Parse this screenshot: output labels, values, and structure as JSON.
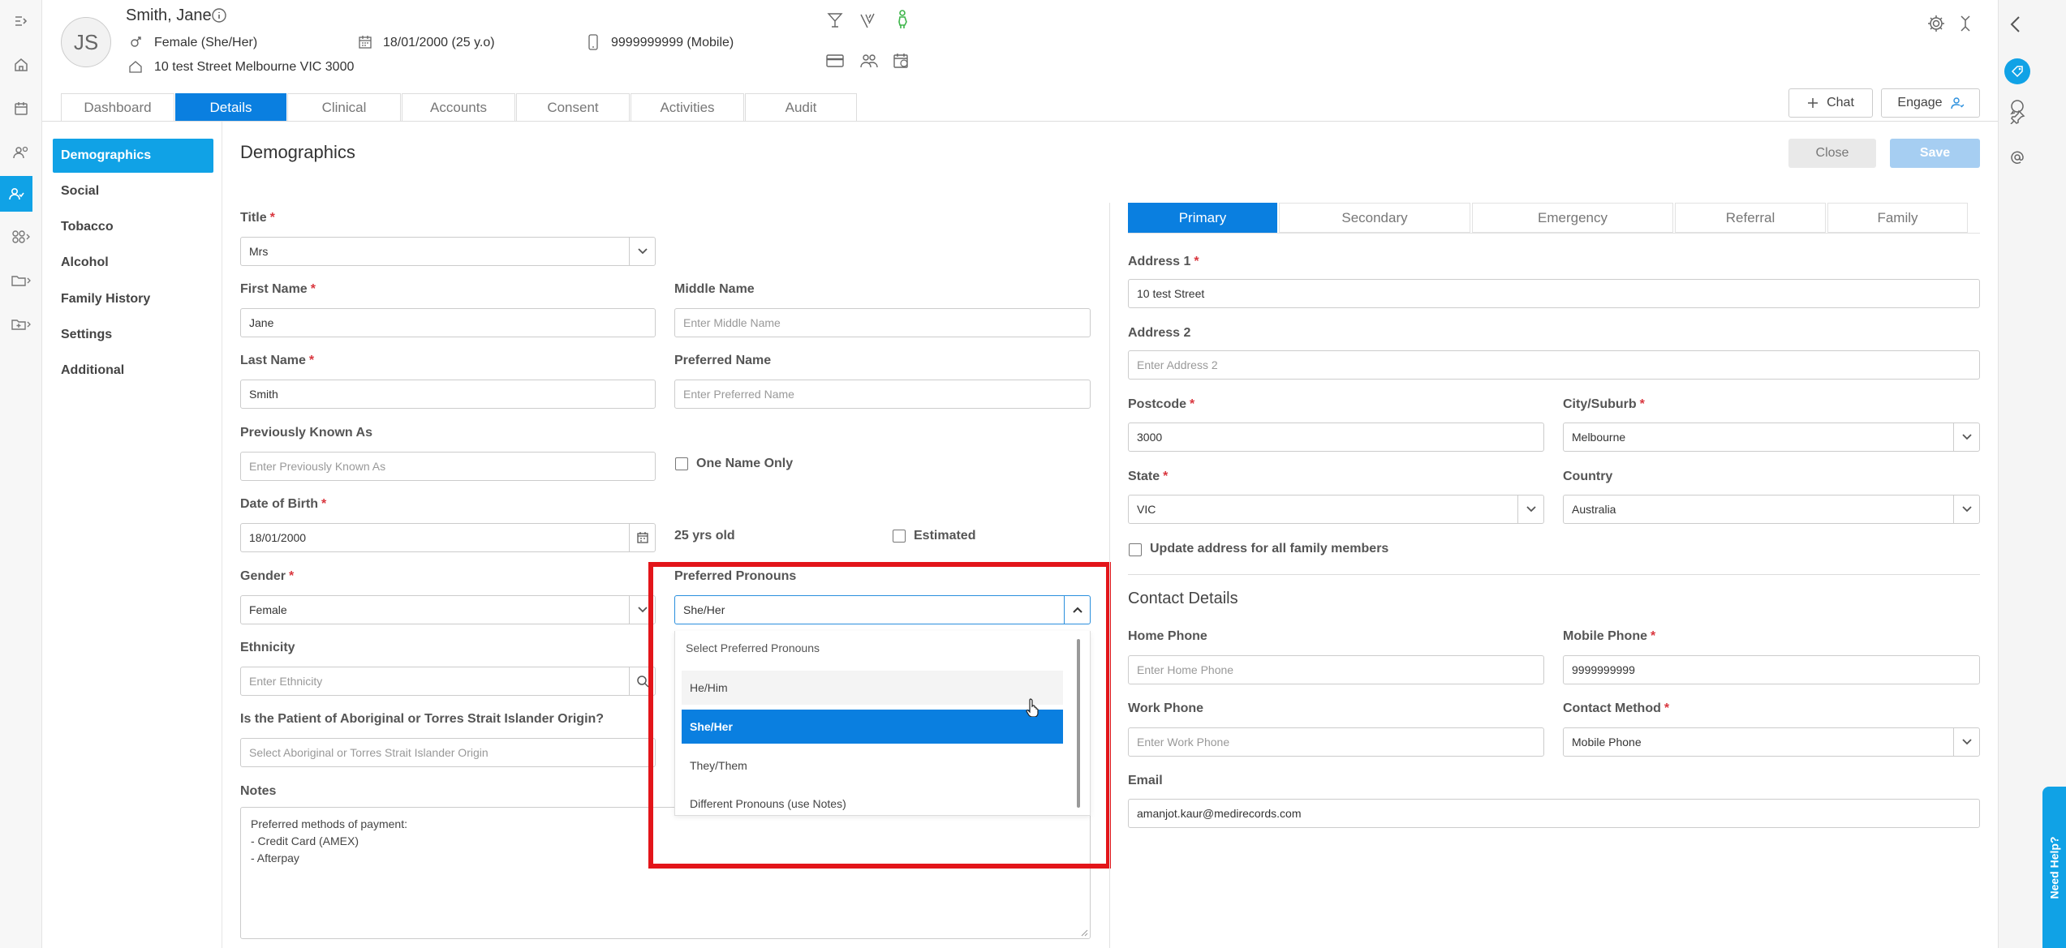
{
  "patient": {
    "initials": "JS",
    "name": "Smith, Jane",
    "gender": "Female (She/Her)",
    "dob": "18/01/2000 (25 y.o)",
    "phone": "9999999999 (Mobile)",
    "address": "10 test Street Melbourne VIC 3000"
  },
  "header_buttons": {
    "chat": "Chat",
    "engage": "Engage"
  },
  "main_tabs": [
    "Dashboard",
    "Details",
    "Clinical",
    "Accounts",
    "Consent",
    "Activities",
    "Audit"
  ],
  "sidebar": [
    "Demographics",
    "Social",
    "Tobacco",
    "Alcohol",
    "Family History",
    "Settings",
    "Additional"
  ],
  "page": {
    "title": "Demographics",
    "close": "Close",
    "save": "Save"
  },
  "form": {
    "title_label": "Title",
    "title_value": "Mrs",
    "first_name_label": "First Name",
    "first_name_value": "Jane",
    "middle_name_label": "Middle Name",
    "middle_name_placeholder": "Enter Middle Name",
    "last_name_label": "Last Name",
    "last_name_value": "Smith",
    "preferred_name_label": "Preferred Name",
    "preferred_name_placeholder": "Enter Preferred Name",
    "prev_known_label": "Previously Known As",
    "prev_known_placeholder": "Enter Previously Known As",
    "one_name_only": "One Name Only",
    "dob_label": "Date of Birth",
    "dob_value": "18/01/2000",
    "age_text": "25 yrs old",
    "estimated": "Estimated",
    "gender_label": "Gender",
    "gender_value": "Female",
    "pronouns_label": "Preferred Pronouns",
    "pronouns_value": "She/Her",
    "ethnicity_label": "Ethnicity",
    "ethnicity_placeholder": "Enter Ethnicity",
    "atsi_label": "Is the Patient of Aboriginal or Torres Strait Islander Origin?",
    "atsi_placeholder": "Select Aboriginal or Torres Strait Islander Origin",
    "notes_label": "Notes",
    "notes_lines": [
      "Preferred methods of payment:",
      "- Credit Card (AMEX)",
      "- Afterpay"
    ]
  },
  "pronoun_dropdown": {
    "header": "Select Preferred Pronouns",
    "options": [
      "He/Him",
      "She/Her",
      "They/Them",
      "Different Pronouns (use Notes)"
    ],
    "selected": "She/Her"
  },
  "address_tabs": [
    "Primary",
    "Secondary",
    "Emergency",
    "Referral",
    "Family"
  ],
  "address": {
    "address1_label": "Address 1",
    "address1_value": "10 test Street",
    "address2_label": "Address 2",
    "address2_placeholder": "Enter Address 2",
    "postcode_label": "Postcode",
    "postcode_value": "3000",
    "city_label": "City/Suburb",
    "city_value": "Melbourne",
    "state_label": "State",
    "state_value": "VIC",
    "country_label": "Country",
    "country_value": "Australia",
    "update_family": "Update address for all family members"
  },
  "contact": {
    "title": "Contact Details",
    "home_label": "Home Phone",
    "home_placeholder": "Enter Home Phone",
    "mobile_label": "Mobile Phone",
    "mobile_value": "9999999999",
    "work_label": "Work Phone",
    "work_placeholder": "Enter Work Phone",
    "method_label": "Contact Method",
    "method_value": "Mobile Phone",
    "email_label": "Email",
    "email_value": "amanjot.kaur@medirecords.com"
  },
  "need_help": "Need Help?",
  "colors": {
    "primary": "#0a7fe0",
    "sidebar_active": "#10a2e6",
    "highlight": "#e3151a",
    "required": "#d9363e"
  }
}
